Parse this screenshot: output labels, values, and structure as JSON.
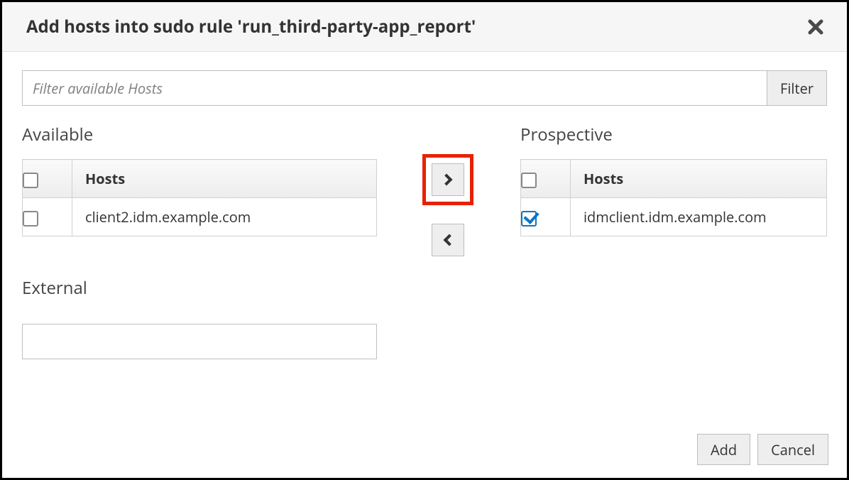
{
  "header": {
    "title": "Add hosts into sudo rule 'run_third-party-app_report'"
  },
  "filter": {
    "placeholder": "Filter available Hosts",
    "button_label": "Filter"
  },
  "available": {
    "heading": "Available",
    "column_label": "Hosts",
    "rows": [
      {
        "host": "client2.idm.example.com",
        "checked": false
      }
    ]
  },
  "prospective": {
    "heading": "Prospective",
    "column_label": "Hosts",
    "rows": [
      {
        "host": "idmclient.idm.example.com",
        "checked": true
      }
    ]
  },
  "external": {
    "heading": "External",
    "value": ""
  },
  "footer": {
    "add_label": "Add",
    "cancel_label": "Cancel"
  }
}
